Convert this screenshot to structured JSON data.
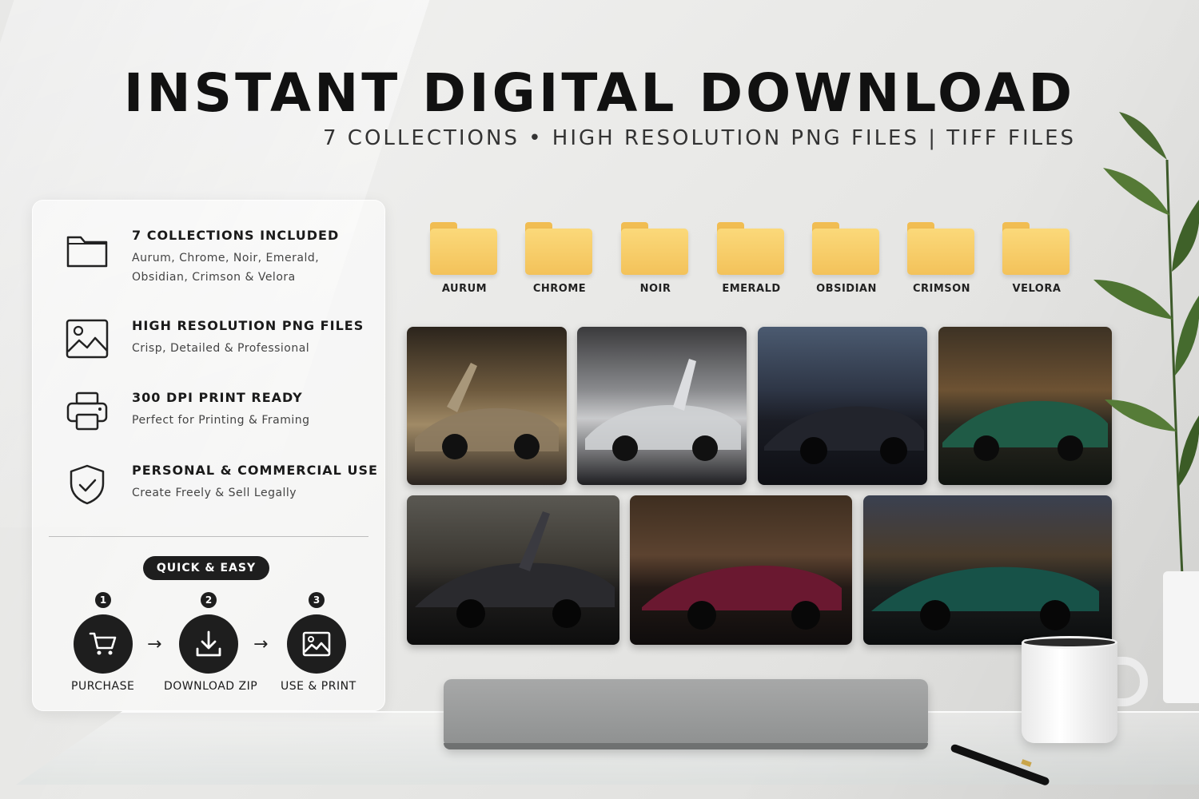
{
  "header": {
    "title": "INSTANT DIGITAL DOWNLOAD",
    "subtitle": "7 COLLECTIONS • HIGH RESOLUTION PNG FILES | TIFF FILES"
  },
  "features": [
    {
      "icon": "folder-icon",
      "title": "7 COLLECTIONS INCLUDED",
      "desc": "Aurum, Chrome, Noir, Emerald, Obsidian, Crimson & Velora"
    },
    {
      "icon": "image-icon",
      "title": "HIGH RESOLUTION PNG FILES",
      "desc": "Crisp, Detailed & Professional"
    },
    {
      "icon": "printer-icon",
      "title": "300 DPI PRINT READY",
      "desc": "Perfect for Printing & Framing"
    },
    {
      "icon": "shield-check-icon",
      "title": "PERSONAL & COMMERCIAL USE",
      "desc": "Create Freely & Sell Legally"
    }
  ],
  "steps": {
    "badge": "QUICK & EASY",
    "items": [
      {
        "num": "1",
        "icon": "cart-icon",
        "label": "PURCHASE"
      },
      {
        "num": "2",
        "icon": "download-icon",
        "label": "DOWNLOAD ZIP"
      },
      {
        "num": "3",
        "icon": "image-icon",
        "label": "USE & PRINT"
      }
    ]
  },
  "folders": [
    "AURUM",
    "CHROME",
    "NOIR",
    "EMERALD",
    "OBSIDIAN",
    "CRIMSON",
    "VELORA"
  ],
  "colors": {
    "folder": "#f3c25a",
    "dark": "#1e1e1e",
    "aurum": "#8a7458",
    "chrome": "#b8bcc2",
    "noir": "#1c1c22",
    "emerald": "#1f5b46",
    "obsidian": "#2a2a2e",
    "crimson": "#6a1830",
    "velora": "#175248"
  }
}
